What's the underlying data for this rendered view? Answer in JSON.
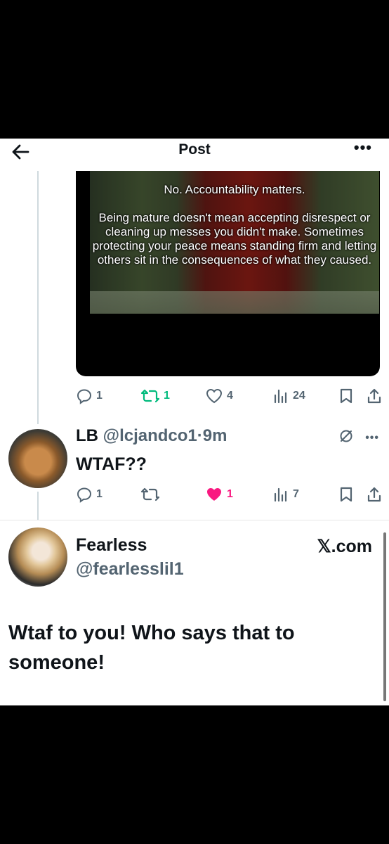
{
  "header": {
    "title": "Post"
  },
  "post": {
    "image_text_line1": "No. Accountability matters.",
    "image_text_body": "Being mature doesn't mean accepting disrespect or cleaning up messes you didn't make. Sometimes protecting your peace means standing firm and letting others sit in the consequences of what they caused.",
    "stats": {
      "replies": "1",
      "reposts": "1",
      "likes": "4",
      "views": "24"
    }
  },
  "reply": {
    "name": "LB",
    "handle": "@lcjandco1",
    "time": "9m",
    "text": "WTAF??",
    "stats": {
      "replies": "1",
      "likes": "1",
      "views": "7"
    }
  },
  "embed": {
    "name": "Fearless",
    "handle": "@fearlesslil1",
    "site": "𝕏.com",
    "text": "Wtaf to you! Who says that to someone!"
  },
  "colors": {
    "repost_green": "#00ba7c",
    "like_pink": "#f91880",
    "gray": "#536471"
  }
}
